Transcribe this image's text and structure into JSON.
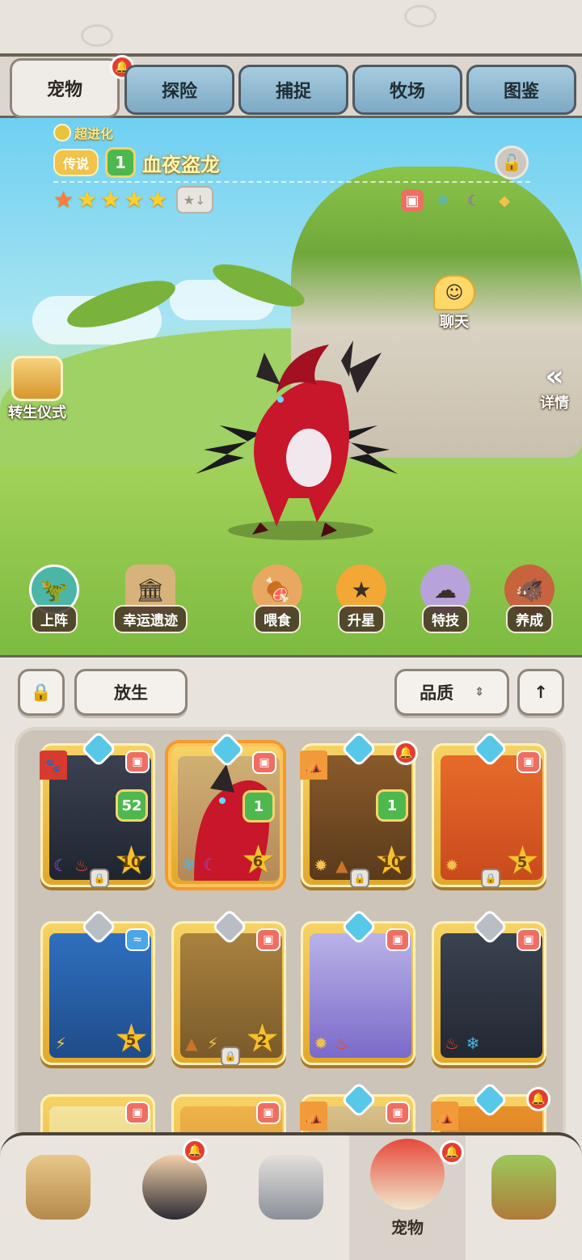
{
  "top_tabs": [
    {
      "label": "宠物",
      "active": true
    },
    {
      "label": "探险",
      "active": false
    },
    {
      "label": "捕捉",
      "active": false
    },
    {
      "label": "牧场",
      "active": false
    },
    {
      "label": "图鉴",
      "active": false
    }
  ],
  "pet": {
    "evolution": "超进化",
    "rarity": "传说",
    "level": "1",
    "name": "血夜盗龙",
    "stars": 5
  },
  "scene_buttons": {
    "chat": "聊天",
    "rebirth": "转生仪式",
    "details": "详情"
  },
  "actions": [
    {
      "label": "上阵",
      "icon": "deploy-icon"
    },
    {
      "label": "幸运遗迹",
      "icon": "relic-icon"
    },
    {
      "label": "喂食",
      "icon": "feed-icon"
    },
    {
      "label": "升星",
      "icon": "star-up-icon"
    },
    {
      "label": "特技",
      "icon": "skill-icon"
    },
    {
      "label": "养成",
      "icon": "train-icon"
    }
  ],
  "controls": {
    "release": "放生",
    "sort": "品质"
  },
  "cards": [
    {
      "level": "52",
      "stars": "10",
      "gem": "blue",
      "flag": "red",
      "locked": true
    },
    {
      "level": "1",
      "stars": "6",
      "gem": "blue",
      "selected": true
    },
    {
      "level": "1",
      "stars": "10",
      "gem": "blue",
      "flag": "orange",
      "locked": true,
      "alert": true
    },
    {
      "level": "",
      "stars": "5",
      "gem": "blue",
      "locked": true
    },
    {
      "level": "",
      "stars": "5",
      "gem": "silver"
    },
    {
      "level": "",
      "stars": "2",
      "gem": "silver",
      "locked": true
    },
    {
      "level": "",
      "stars": "",
      "gem": "blue"
    },
    {
      "level": "",
      "stars": "",
      "gem": "silver"
    }
  ],
  "bottom_nav": [
    {
      "label": "",
      "icon": "tribe-icon"
    },
    {
      "label": "",
      "icon": "hero-icon"
    },
    {
      "label": "",
      "icon": "equipment-icon"
    },
    {
      "label": "宠物",
      "icon": "pet-icon",
      "active": true
    },
    {
      "label": "",
      "icon": "totem-icon"
    }
  ],
  "colors": {
    "accent_gold": "#f2c24a",
    "alert_red": "#e53c32",
    "level_green": "#4db84e"
  }
}
